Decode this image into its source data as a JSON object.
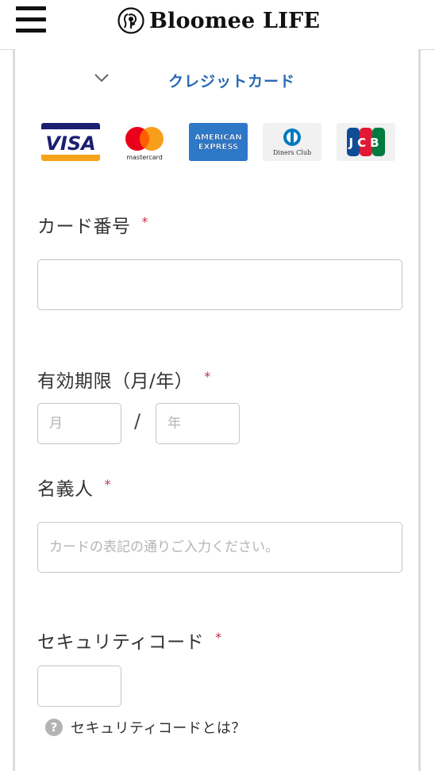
{
  "header": {
    "logo_text": "Bloomee LIFE",
    "menu_icon": "hamburger-menu-icon"
  },
  "payment": {
    "method_title": "クレジットカード",
    "toggle_icon": "chevron-down-icon",
    "brands": [
      {
        "name": "VISA",
        "icon": "visa-logo"
      },
      {
        "name": "mastercard",
        "icon": "mastercard-logo"
      },
      {
        "name": "AMERICAN EXPRESS",
        "icon": "amex-logo"
      },
      {
        "name": "Diners Club",
        "icon": "diners-club-logo"
      },
      {
        "name": "JCB",
        "icon": "jcb-logo"
      }
    ]
  },
  "form": {
    "card_number": {
      "label": "カード番号",
      "required_mark": "*",
      "value": "",
      "placeholder": ""
    },
    "expiry": {
      "label": "有効期限（月/年）",
      "required_mark": "*",
      "month_placeholder": "月",
      "year_placeholder": "年",
      "separator": "/"
    },
    "holder": {
      "label": "名義人",
      "required_mark": "*",
      "placeholder": "カードの表記の通りご入力ください。"
    },
    "security_code": {
      "label": "セキュリティコード",
      "required_mark": "*",
      "value": ""
    },
    "help": {
      "icon_glyph": "?",
      "text": "セキュリティコードとは？"
    }
  },
  "colors": {
    "accent": "#2769b3",
    "required": "#c1304b",
    "border": "#c6c6c6"
  }
}
